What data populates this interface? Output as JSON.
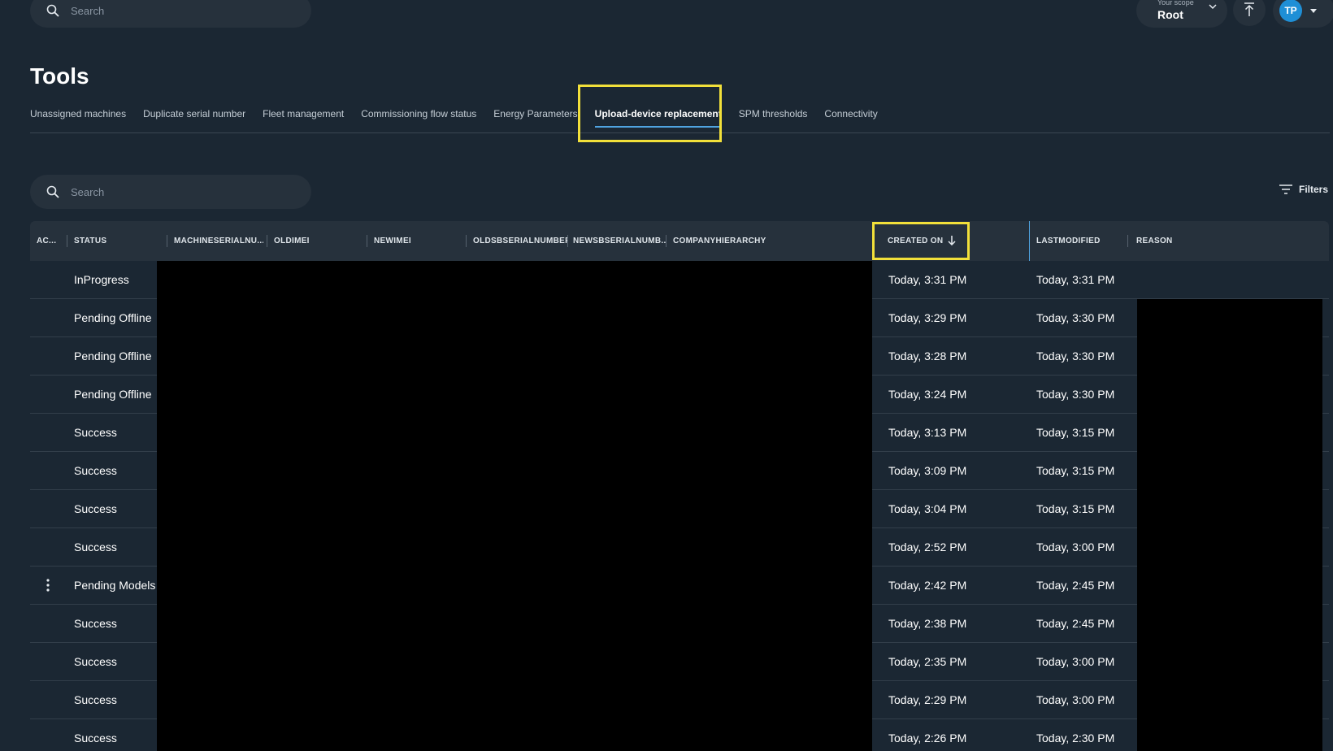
{
  "topbar": {
    "search_placeholder": "Search",
    "scope_label": "Your scope",
    "scope_value": "Root",
    "user_initials": "TP"
  },
  "page": {
    "title": "Tools"
  },
  "tabs": [
    {
      "label": "Unassigned machines",
      "active": false
    },
    {
      "label": "Duplicate serial number",
      "active": false
    },
    {
      "label": "Fleet management",
      "active": false
    },
    {
      "label": "Commissioning flow status",
      "active": false
    },
    {
      "label": "Energy Parameters",
      "active": false
    },
    {
      "label": "Upload-device replacement",
      "active": true
    },
    {
      "label": "SPM thresholds",
      "active": false
    },
    {
      "label": "Connectivity",
      "active": false
    }
  ],
  "table_search": {
    "placeholder": "Search"
  },
  "filters": {
    "label": "Filters"
  },
  "table": {
    "columns": {
      "actions": "AC...",
      "status": "STATUS",
      "machine_serial": "MACHINESERIALNU...",
      "old_imei": "OLDIMEI",
      "new_imei": "NEWIMEI",
      "old_sb_serial": "OLDSBSERIALNUMBER",
      "new_sb_serial": "NEWSBSERIALNUMB...",
      "company_hierarchy": "COMPANYHIERARCHY",
      "created_on": "CREATED ON",
      "last_modified": "LASTMODIFIED",
      "reason": "REASON"
    },
    "rows": [
      {
        "status": "InProgress",
        "created": "Today, 3:31 PM",
        "modified": "Today, 3:31 PM",
        "menu": false
      },
      {
        "status": "Pending Offline",
        "created": "Today, 3:29 PM",
        "modified": "Today, 3:30 PM",
        "menu": false
      },
      {
        "status": "Pending Offline",
        "created": "Today, 3:28 PM",
        "modified": "Today, 3:30 PM",
        "menu": false
      },
      {
        "status": "Pending Offline",
        "created": "Today, 3:24 PM",
        "modified": "Today, 3:30 PM",
        "menu": false
      },
      {
        "status": "Success",
        "created": "Today, 3:13 PM",
        "modified": "Today, 3:15 PM",
        "menu": false
      },
      {
        "status": "Success",
        "created": "Today, 3:09 PM",
        "modified": "Today, 3:15 PM",
        "menu": false
      },
      {
        "status": "Success",
        "created": "Today, 3:04 PM",
        "modified": "Today, 3:15 PM",
        "menu": false
      },
      {
        "status": "Success",
        "created": "Today, 2:52 PM",
        "modified": "Today, 3:00 PM",
        "menu": false
      },
      {
        "status": "Pending Models",
        "created": "Today, 2:42 PM",
        "modified": "Today, 2:45 PM",
        "menu": true
      },
      {
        "status": "Success",
        "created": "Today, 2:38 PM",
        "modified": "Today, 2:45 PM",
        "menu": false
      },
      {
        "status": "Success",
        "created": "Today, 2:35 PM",
        "modified": "Today, 3:00 PM",
        "menu": false
      },
      {
        "status": "Success",
        "created": "Today, 2:29 PM",
        "modified": "Today, 3:00 PM",
        "menu": false
      },
      {
        "status": "Success",
        "created": "Today, 2:26 PM",
        "modified": "Today, 2:30 PM",
        "menu": false
      }
    ]
  },
  "colors": {
    "background": "#1b2733",
    "surface": "#26313c",
    "accent": "#4fa3e0",
    "highlight": "#f2e03a",
    "avatar": "#1f8fd6"
  },
  "icons": [
    "search-icon",
    "chevron-down-icon",
    "upload-icon",
    "caret-down-icon",
    "filter-icon",
    "arrow-down-icon",
    "kebab-icon"
  ]
}
